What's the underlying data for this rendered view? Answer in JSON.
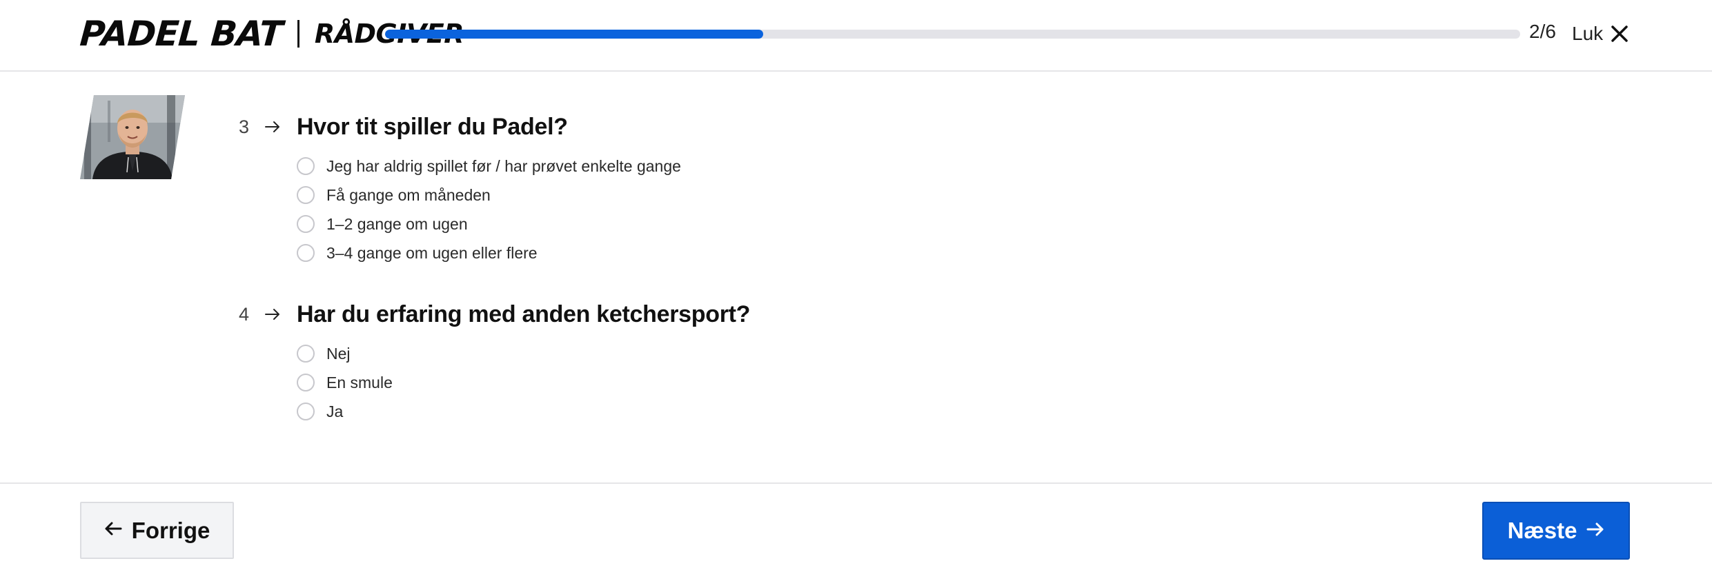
{
  "header": {
    "brand_name": "PADEL BAT",
    "brand_sub": "RÅDGIVER",
    "progress_fraction": 0.333,
    "step_count": "2/6",
    "close_label": "Luk"
  },
  "questions": [
    {
      "number": "3",
      "title": "Hvor tit spiller du Padel?",
      "options": [
        "Jeg har aldrig spillet før / har prøvet enkelte gange",
        "Få gange om måneden",
        "1–2 gange om ugen",
        "3–4 gange om ugen eller flere"
      ]
    },
    {
      "number": "4",
      "title": "Har du erfaring med anden ketchersport?",
      "options": [
        "Nej",
        "En smule",
        "Ja"
      ]
    }
  ],
  "footer": {
    "prev_label": "Forrige",
    "next_label": "Næste"
  },
  "colors": {
    "accent": "#0b63dd",
    "track": "#e3e3e8"
  },
  "icons": {
    "close": "close-icon",
    "question_arrow": "arrow-right-icon",
    "prev": "arrow-left-icon",
    "next": "arrow-right-icon"
  }
}
